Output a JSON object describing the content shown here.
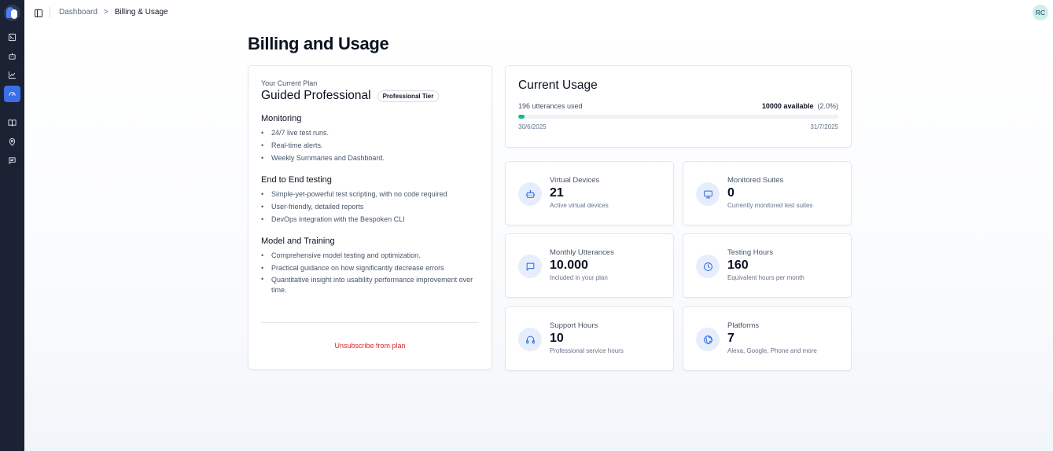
{
  "breadcrumb": {
    "items": [
      "Dashboard",
      "Billing & Usage"
    ],
    "separator": ">"
  },
  "user": {
    "initials": "RC"
  },
  "page": {
    "title": "Billing and Usage"
  },
  "plan": {
    "label": "Your Current Plan",
    "name": "Guided Professional",
    "tier": "Professional Tier",
    "sections": [
      {
        "title": "Monitoring",
        "items": [
          "24/7 live test runs.",
          "Real-time alerts.",
          "Weekly Summaries and Dashboard."
        ]
      },
      {
        "title": "End to End testing",
        "items": [
          "Simple-yet-powerful test scripting, with no code required",
          "User-friendly, detailed reports",
          "DevOps integration with the Bespoken CLI"
        ]
      },
      {
        "title": "Model and Training",
        "items": [
          "Comprehensive model testing and optimization.",
          "Practical guidance on how significantly decrease errors",
          "Quantitative insight into usability performance improvement over time."
        ]
      }
    ],
    "unsubscribe_label": "Unsubscribe from plan"
  },
  "usage": {
    "title": "Current Usage",
    "used_text": "196 utterances used",
    "available_text": "10000 available",
    "percent_text": "(2.0%)",
    "progress_fraction": 0.0196,
    "start_date": "30/6/2025",
    "end_date": "31/7/2025"
  },
  "stats": [
    {
      "label": "Virtual Devices",
      "value": "21",
      "desc": "Active virtual devices",
      "icon": "robot-icon"
    },
    {
      "label": "Monitored Suites",
      "value": "0",
      "desc": "Currently monitored test suites",
      "icon": "monitor-icon"
    },
    {
      "label": "Monthly Utterances",
      "value": "10.000",
      "desc": "Included in your plan",
      "icon": "chat-icon"
    },
    {
      "label": "Testing Hours",
      "value": "160",
      "desc": "Equivalent hours per month",
      "icon": "clock-icon"
    },
    {
      "label": "Support Hours",
      "value": "10",
      "desc": "Professional service hours",
      "icon": "headphones-icon"
    },
    {
      "label": "Platforms",
      "value": "7",
      "desc": "Alexa, Google, Phone and more",
      "icon": "globe-icon"
    }
  ],
  "colors": {
    "accent": "#3b6fe8",
    "progress": "#10b981",
    "danger": "#dc2626",
    "sidebar": "#1a2233"
  }
}
